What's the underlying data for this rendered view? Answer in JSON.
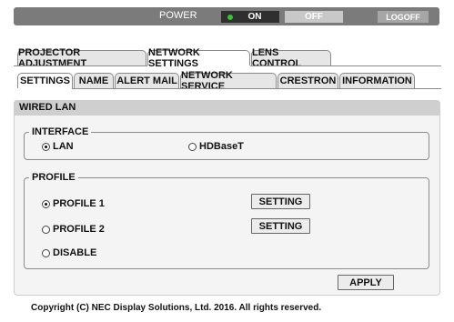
{
  "power": {
    "label": "POWER",
    "on_label": "ON",
    "off_label": "OFF",
    "logoff_label": "LOGOFF",
    "state": "ON"
  },
  "main_tabs": [
    {
      "label": "PROJECTOR ADJUSTMENT",
      "active": false
    },
    {
      "label": "NETWORK SETTINGS",
      "active": true
    },
    {
      "label": "LENS CONTROL",
      "active": false
    }
  ],
  "sub_tabs": [
    {
      "label": "SETTINGS",
      "active": true
    },
    {
      "label": "NAME",
      "active": false
    },
    {
      "label": "ALERT MAIL",
      "active": false
    },
    {
      "label": "NETWORK SERVICE",
      "active": false
    },
    {
      "label": "CRESTRON",
      "active": false
    },
    {
      "label": "INFORMATION",
      "active": false
    }
  ],
  "panel": {
    "title": "WIRED LAN",
    "interface": {
      "legend": "INTERFACE",
      "options": [
        {
          "label": "LAN",
          "checked": true
        },
        {
          "label": "HDBaseT",
          "checked": false
        }
      ]
    },
    "profile": {
      "legend": "PROFILE",
      "options": [
        {
          "label": "PROFILE 1",
          "checked": true,
          "button": "SETTING"
        },
        {
          "label": "PROFILE 2",
          "checked": false,
          "button": "SETTING"
        },
        {
          "label": "DISABLE",
          "checked": false
        }
      ]
    },
    "apply_label": "APPLY"
  },
  "footer": {
    "copyright": "Copyright (C) NEC Display Solutions, Ltd. 2016. All rights reserved."
  },
  "colors": {
    "power_bar": "#7b7b7b",
    "on_led": "#3cc13c",
    "panel_header": "#cfcfcf",
    "panel_bg": "#f4f4f4"
  }
}
